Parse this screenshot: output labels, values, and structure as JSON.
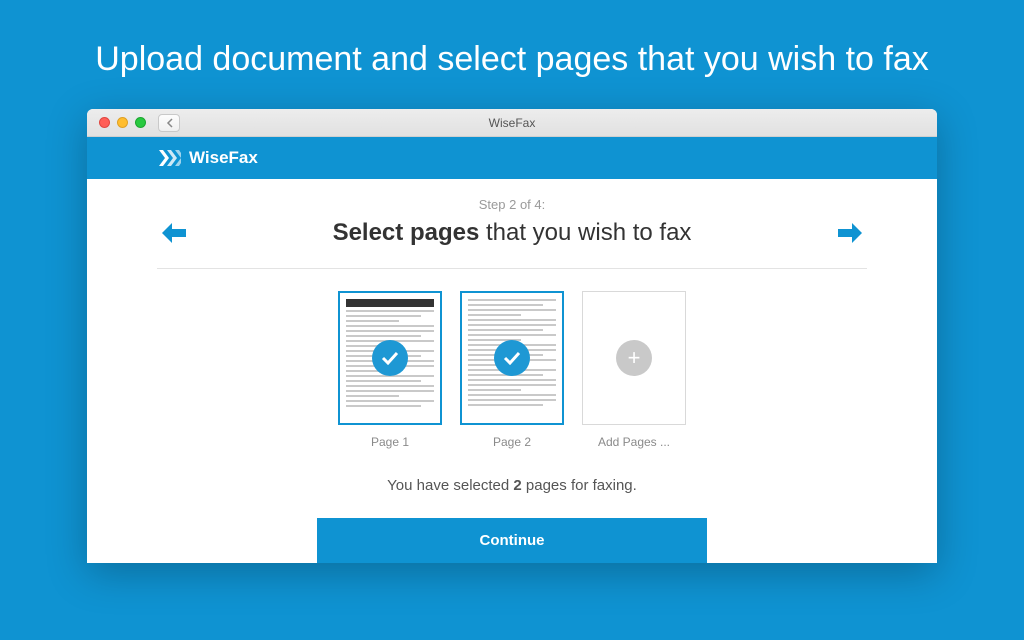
{
  "pageTitle": "Upload document and select pages that you wish to fax",
  "browser": {
    "title": "WiseFax"
  },
  "header": {
    "brand": "WiseFax"
  },
  "step": {
    "label": "Step 2 of 4:"
  },
  "heading": {
    "bold": "Select pages",
    "rest": " that you wish to fax"
  },
  "thumbs": {
    "page1": "Page 1",
    "page2": "Page 2",
    "add": "Add Pages ..."
  },
  "selected": {
    "pre": "You have selected ",
    "count": "2",
    "post": " pages for faxing."
  },
  "buttons": {
    "continue": "Continue"
  },
  "colors": {
    "brand": "#0f93d2"
  }
}
